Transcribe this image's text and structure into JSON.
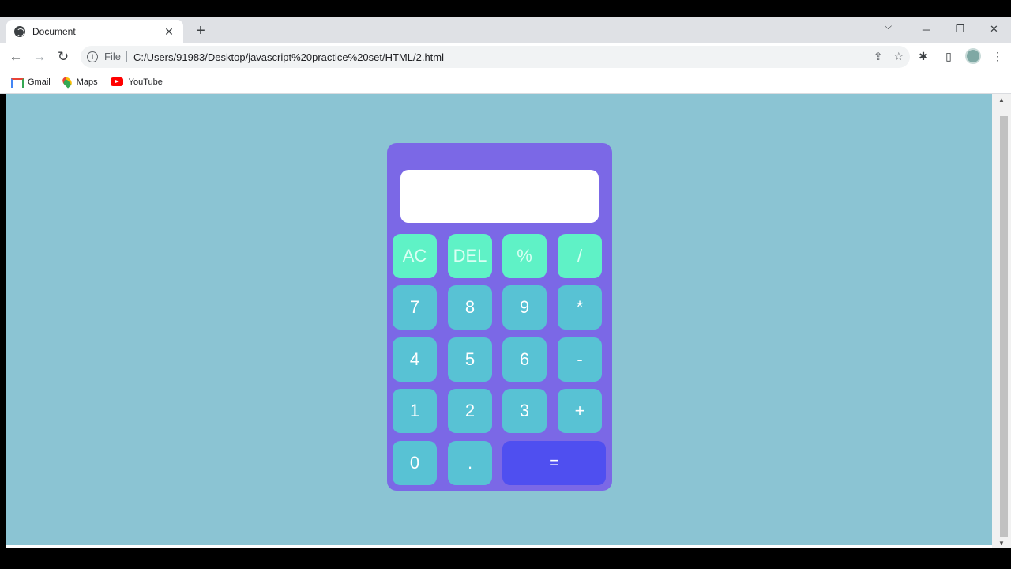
{
  "browser": {
    "tab_title": "Document",
    "new_tab": "+",
    "tab_close": "✕",
    "tab_search": "⌵",
    "window": {
      "minimize": "─",
      "restore": "❐",
      "close": "✕"
    },
    "nav": {
      "back": "←",
      "forward": "→",
      "reload": "↻"
    },
    "address": {
      "scheme": "File",
      "url": "C:/Users/91983/Desktop/javascript%20practice%20set/HTML/2.html"
    },
    "bookmarks": [
      {
        "label": "Gmail"
      },
      {
        "label": "Maps"
      },
      {
        "label": "YouTube"
      }
    ]
  },
  "calculator": {
    "display_value": "",
    "row1": [
      "AC",
      "DEL",
      "%",
      "/"
    ],
    "row2": [
      "7",
      "8",
      "9",
      "*"
    ],
    "row3": [
      "4",
      "5",
      "6",
      "-"
    ],
    "row4": [
      "1",
      "2",
      "3",
      "+"
    ],
    "row5": [
      "0",
      ".",
      "="
    ]
  },
  "colors": {
    "page_bg": "#8bc4d3",
    "calc_bg": "#7b68e6",
    "top_keys": "#5ff2c6",
    "num_keys": "#58c2d4",
    "equals_key": "#4f4ff0"
  }
}
